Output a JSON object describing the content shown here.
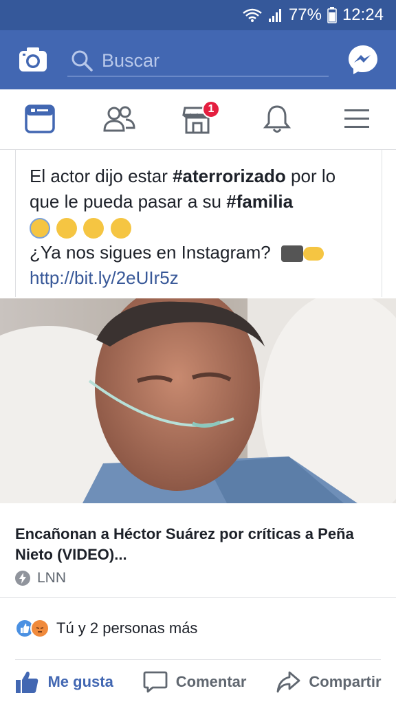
{
  "status_bar": {
    "battery": "77%",
    "time": "12:24"
  },
  "header": {
    "search_placeholder": "Buscar"
  },
  "tabs": [
    {
      "name": "news-feed"
    },
    {
      "name": "friends"
    },
    {
      "name": "marketplace",
      "badge": "1"
    },
    {
      "name": "notifications"
    },
    {
      "name": "menu"
    }
  ],
  "post": {
    "text_line1_pre": "El actor dijo estar ",
    "text_hashtag1": "#aterrorizado",
    "text_line1_post": " por lo que le pueda pasar a su ",
    "text_hashtag2": "#familia",
    "text_line3": "¿Ya nos sigues en Instagram? ",
    "link": "http://bit.ly/2eUIr5z"
  },
  "link_preview": {
    "title": "Encañonan a Héctor Suárez por críticas a Peña Nieto (VIDEO)...",
    "source": "LNN"
  },
  "reactions": {
    "text": "Tú y 2 personas más"
  },
  "actions": {
    "like": "Me gusta",
    "comment": "Comentar",
    "share": "Compartir"
  },
  "colors": {
    "header_bg": "#4267b2",
    "status_bg": "#35589a",
    "accent": "#4267b2",
    "badge": "#e41e3f"
  }
}
